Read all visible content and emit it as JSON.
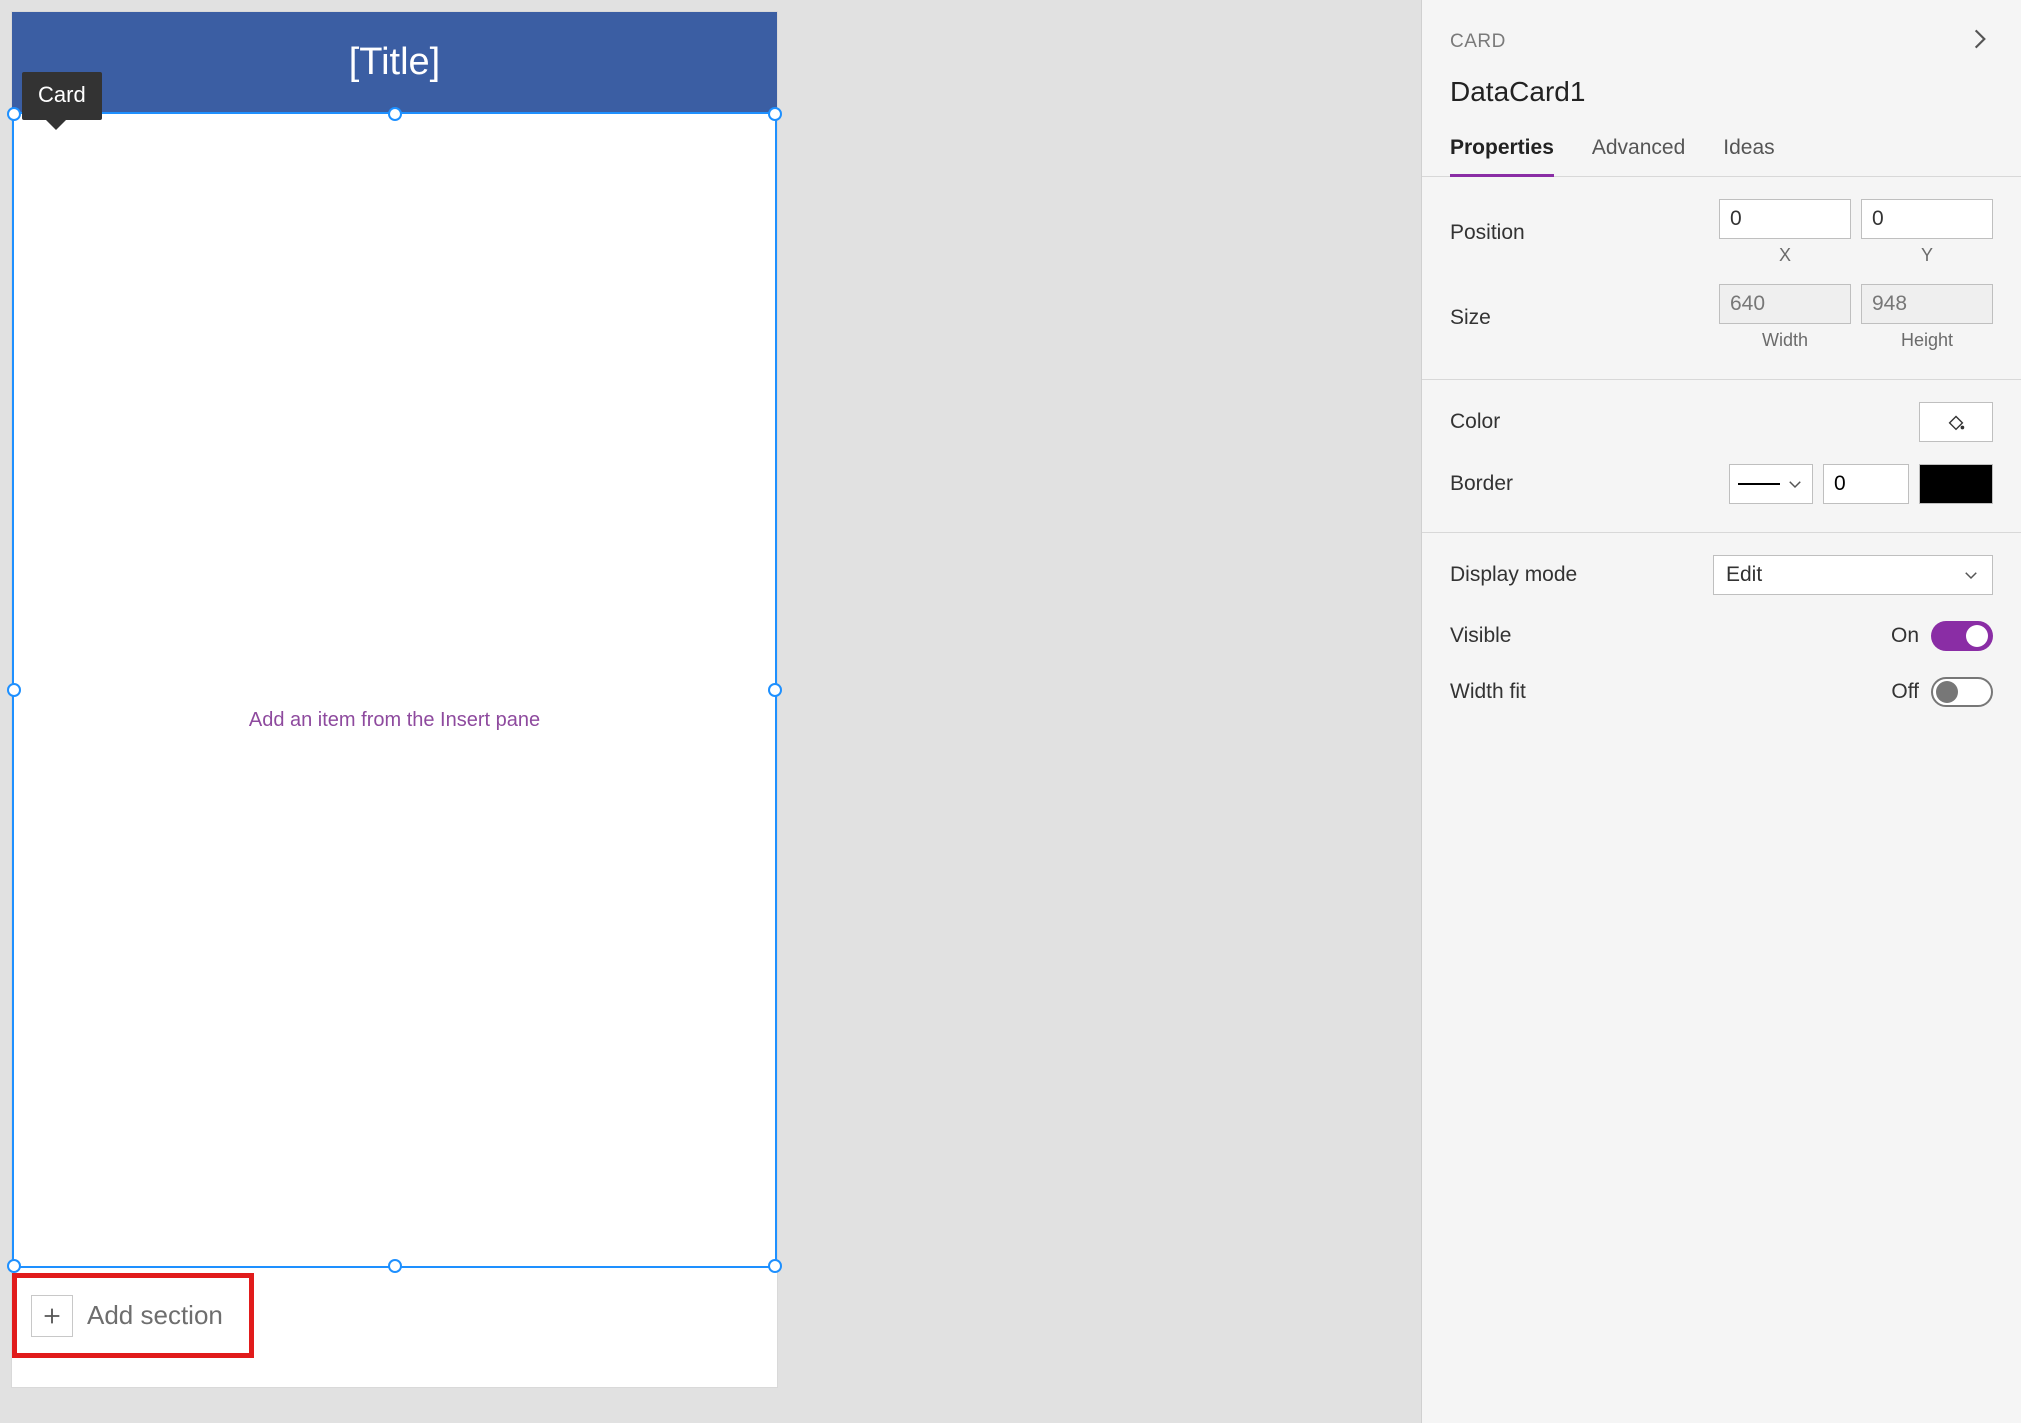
{
  "tooltip": {
    "label": "Card"
  },
  "canvas": {
    "title": "[Title]",
    "placeholder": "Add an item from the Insert pane",
    "add_section_label": "Add section"
  },
  "panel": {
    "type_label": "CARD",
    "name": "DataCard1",
    "tabs": {
      "properties": "Properties",
      "advanced": "Advanced",
      "ideas": "Ideas"
    },
    "position": {
      "label": "Position",
      "x": "0",
      "y": "0",
      "x_label": "X",
      "y_label": "Y"
    },
    "size": {
      "label": "Size",
      "width": "640",
      "height": "948",
      "w_label": "Width",
      "h_label": "Height"
    },
    "color": {
      "label": "Color"
    },
    "border": {
      "label": "Border",
      "weight": "0"
    },
    "display_mode": {
      "label": "Display mode",
      "value": "Edit"
    },
    "visible": {
      "label": "Visible",
      "state_text": "On",
      "on": true
    },
    "width_fit": {
      "label": "Width fit",
      "state_text": "Off",
      "on": false
    }
  }
}
